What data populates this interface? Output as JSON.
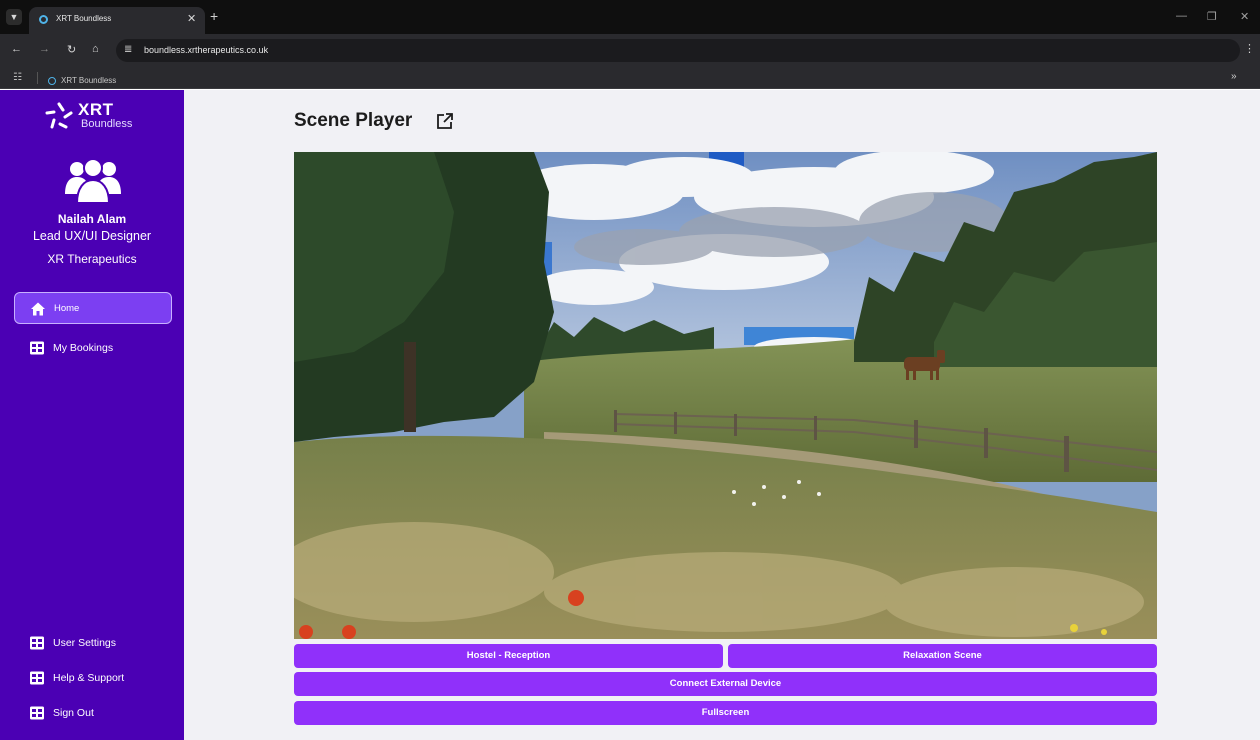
{
  "browser": {
    "tab_title": "XRT Boundless",
    "url": "boundless.xrtherapeutics.co.uk",
    "bookmark_label": "XRT Boundless"
  },
  "sidebar": {
    "logo_main": "XRT",
    "logo_sub": "Boundless",
    "user_name": "Nailah Alam",
    "user_role": "Lead UX/UI Designer",
    "user_company": "XR Therapeutics",
    "nav_items": [
      {
        "label": "Home",
        "icon": "home-icon",
        "active": true
      },
      {
        "label": "My Bookings",
        "icon": "bookings-icon",
        "active": false
      }
    ],
    "bottom_items": [
      {
        "label": "User Settings",
        "icon": "user-settings-icon"
      },
      {
        "label": "Help & Support",
        "icon": "help-support-icon"
      },
      {
        "label": "Sign Out",
        "icon": "sign-out-icon"
      }
    ]
  },
  "main": {
    "title": "Scene Player",
    "buttons": {
      "scene_a": "Hostel - Reception",
      "scene_b": "Relaxation Scene",
      "connect": "Connect External Device",
      "fullscreen": "Fullscreen"
    }
  },
  "colors": {
    "sidebar_bg": "#4b00b4",
    "nav_active_bg": "#7c3ff2",
    "button_bg": "#9030fa",
    "page_bg": "#f1f1f5"
  }
}
